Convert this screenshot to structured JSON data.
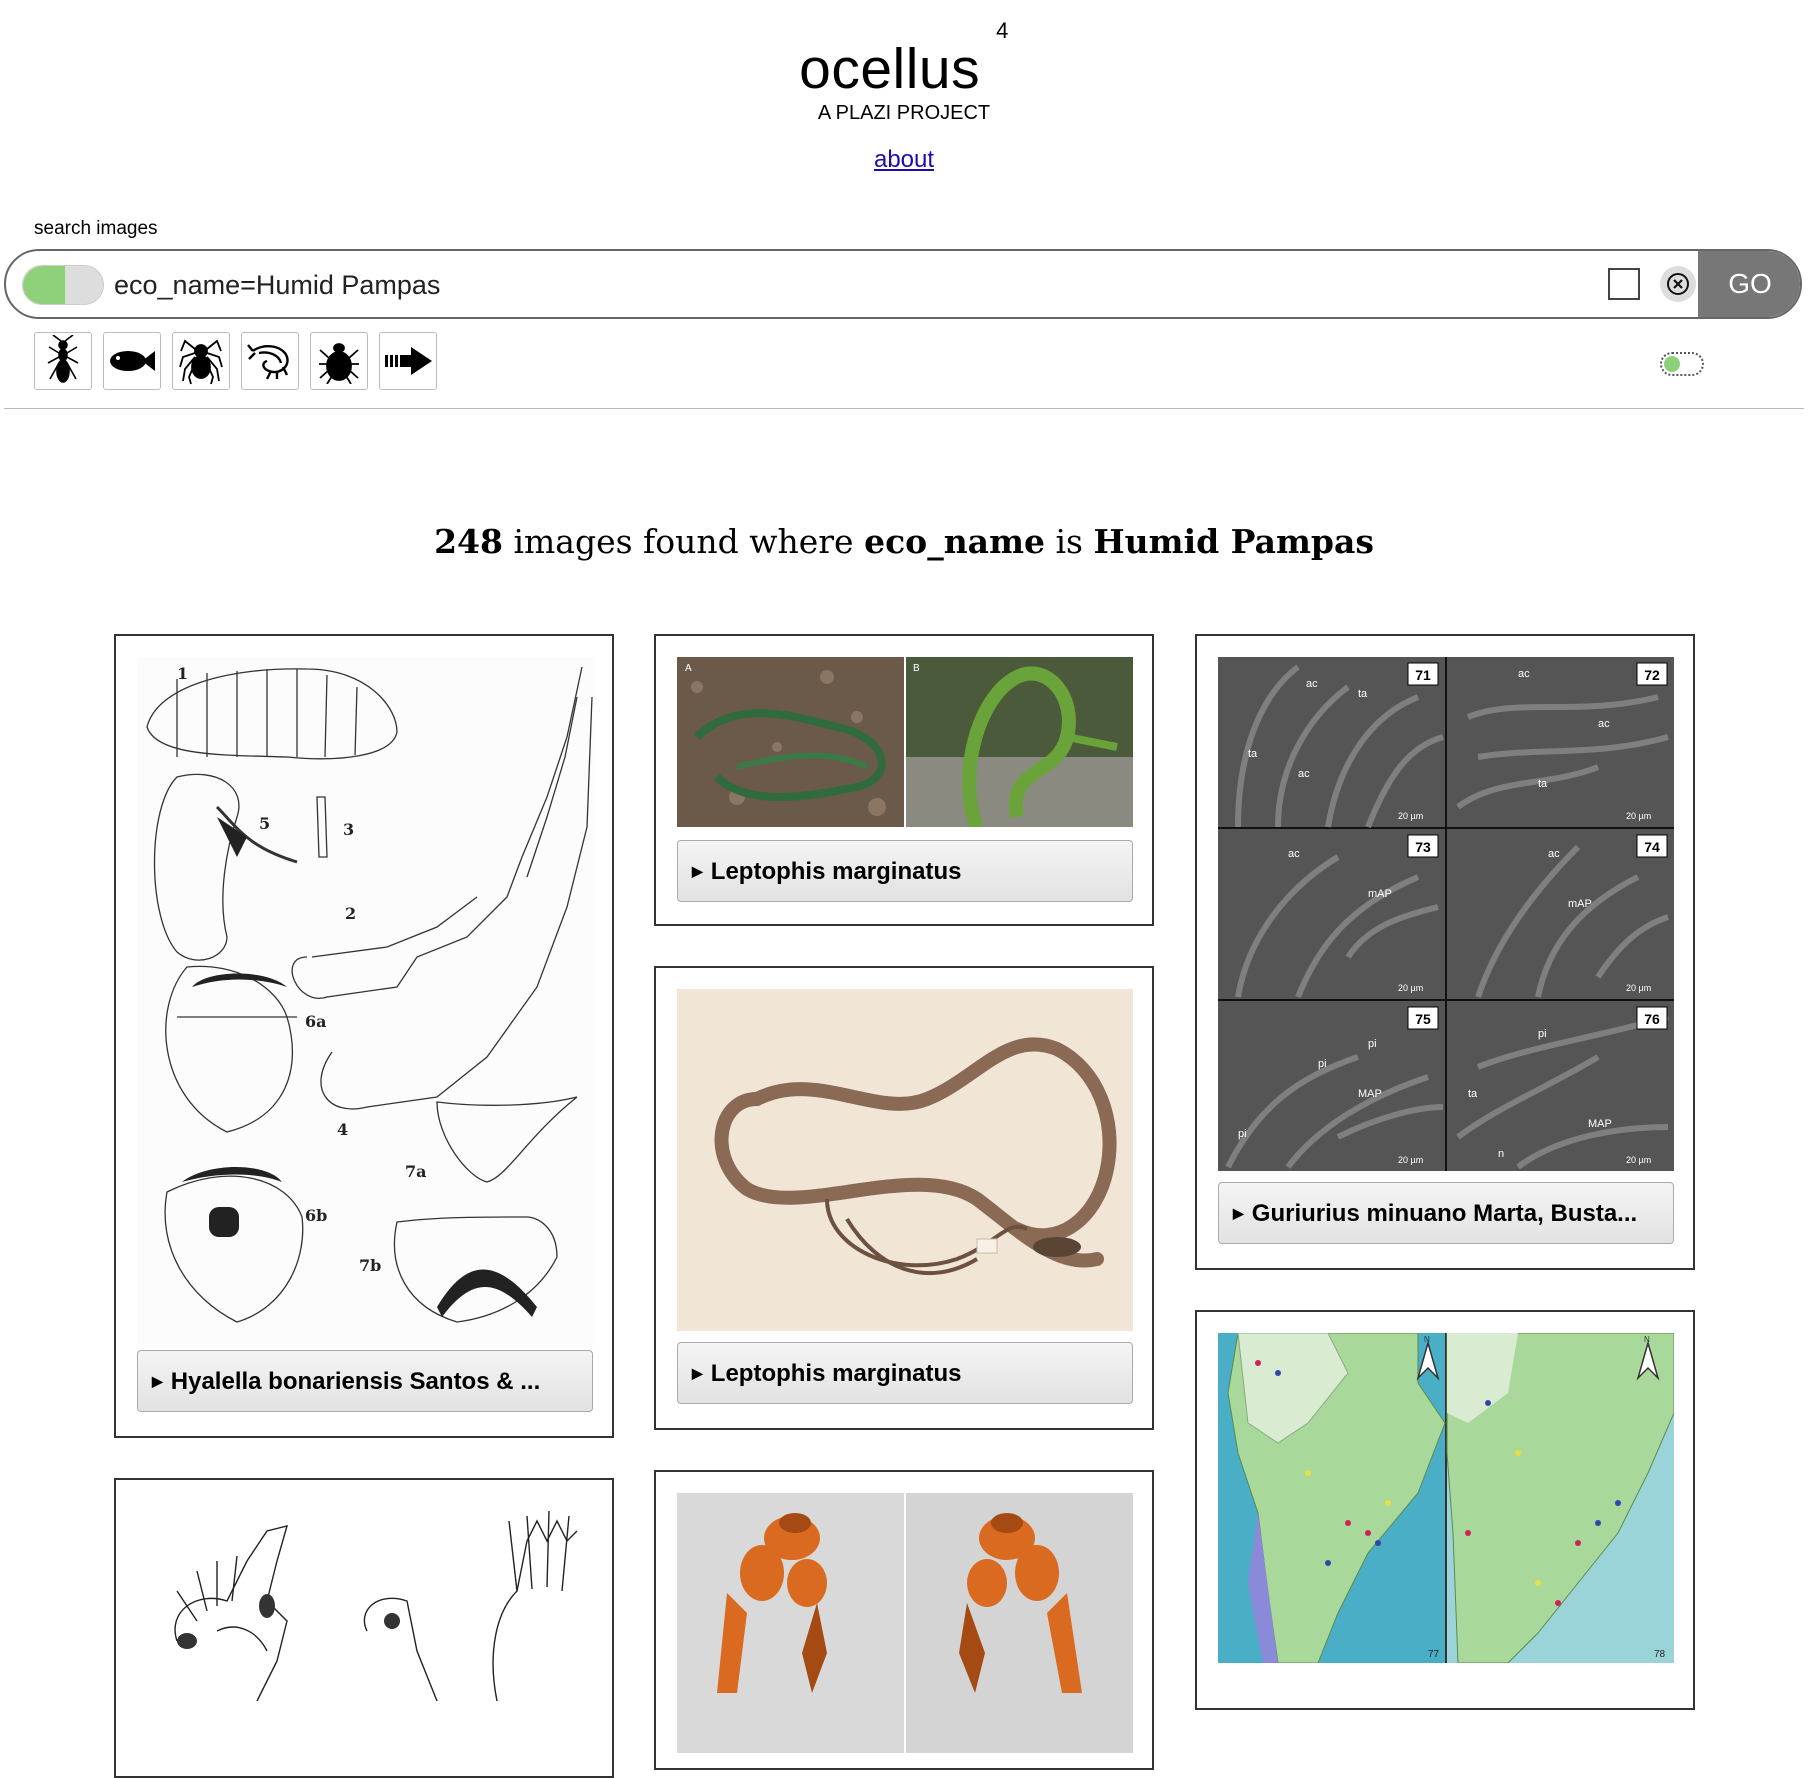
{
  "header": {
    "logo": "ocellus",
    "version": "4",
    "subtitle": "A PLAZI PROJECT",
    "about_link": "about"
  },
  "search": {
    "label": "search images",
    "query": "eco_name=Humid Pampas",
    "go_label": "GO",
    "toggle_state": "on",
    "checkbox_checked": false
  },
  "shortcuts": [
    {
      "icon": "insect-icon"
    },
    {
      "icon": "fish-icon"
    },
    {
      "icon": "spider-icon"
    },
    {
      "icon": "shrimp-icon"
    },
    {
      "icon": "tick-icon"
    },
    {
      "icon": "arrow-right-icon"
    }
  ],
  "results": {
    "count": "248",
    "text_images_found_where": "images found where",
    "field": "eco_name",
    "text_is": "is",
    "value": "Humid Pampas"
  },
  "cards": {
    "hyalella": {
      "caption": "Hyalella bonariensis Santos & ...",
      "figure_labels": [
        "1",
        "2",
        "3",
        "4",
        "5",
        "6a",
        "6b",
        "7a",
        "7b"
      ]
    },
    "leptophis_1": {
      "caption": "Leptophis marginatus",
      "panel_labels": [
        "A",
        "B"
      ]
    },
    "leptophis_2": {
      "caption": "Leptophis marginatus"
    },
    "guriurius": {
      "caption": "Guriurius minuano Marta, Busta...",
      "panel_numbers": [
        "71",
        "72",
        "73",
        "74",
        "75",
        "76"
      ],
      "scale_label": "20 µm",
      "annotations": [
        "ac",
        "ta",
        "mAP",
        "MAP",
        "pi",
        "n"
      ]
    },
    "map": {
      "caption": "",
      "panel_numbers": [
        "77",
        "78"
      ],
      "north_label": "N"
    },
    "drawing": {
      "caption": ""
    },
    "spider_legs": {
      "caption": ""
    }
  },
  "colors": {
    "toggle_on": "#8fd17a",
    "go_button": "#777777",
    "link": "#1a0dab"
  }
}
